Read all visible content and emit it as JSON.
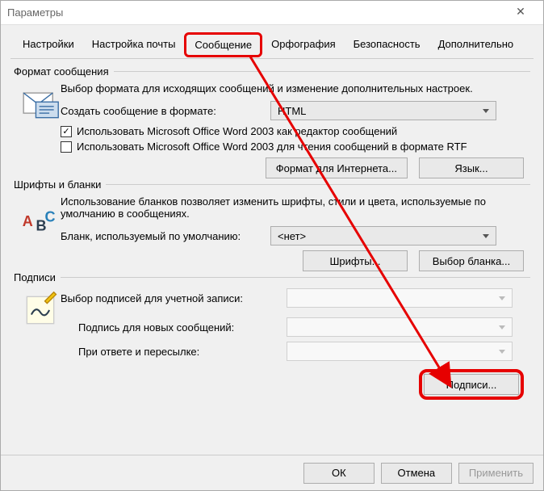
{
  "window": {
    "title": "Параметры"
  },
  "tabs": {
    "t0": "Настройки",
    "t1": "Настройка почты",
    "t2": "Сообщение",
    "t3": "Орфография",
    "t4": "Безопасность",
    "t5": "Дополнительно"
  },
  "format": {
    "group": "Формат сообщения",
    "desc": "Выбор формата для исходящих сообщений и изменение дополнительных настроек.",
    "create_label": "Создать сообщение в формате:",
    "create_value": "HTML",
    "cb1": "Использовать Microsoft Office Word 2003 как редактор сообщений",
    "cb2": "Использовать Microsoft Office Word 2003 для чтения сообщений в формате RTF",
    "btn_internet": "Формат для Интернета...",
    "btn_lang": "Язык..."
  },
  "fonts": {
    "group": "Шрифты и бланки",
    "desc": "Использование бланков позволяет изменить шрифты, стили и цвета, используемые по умолчанию в сообщениях.",
    "blank_label": "Бланк, используемый по умолчанию:",
    "blank_value": "<нет>",
    "btn_fonts": "Шрифты...",
    "btn_blank": "Выбор бланка..."
  },
  "sig": {
    "group": "Подписи",
    "account_label": "Выбор подписей для учетной записи:",
    "new_label": "Подпись для новых сообщений:",
    "reply_label": "При ответе и пересылке:",
    "btn_sig": "Подписи..."
  },
  "footer": {
    "ok": "ОК",
    "cancel": "Отмена",
    "apply": "Применить"
  }
}
